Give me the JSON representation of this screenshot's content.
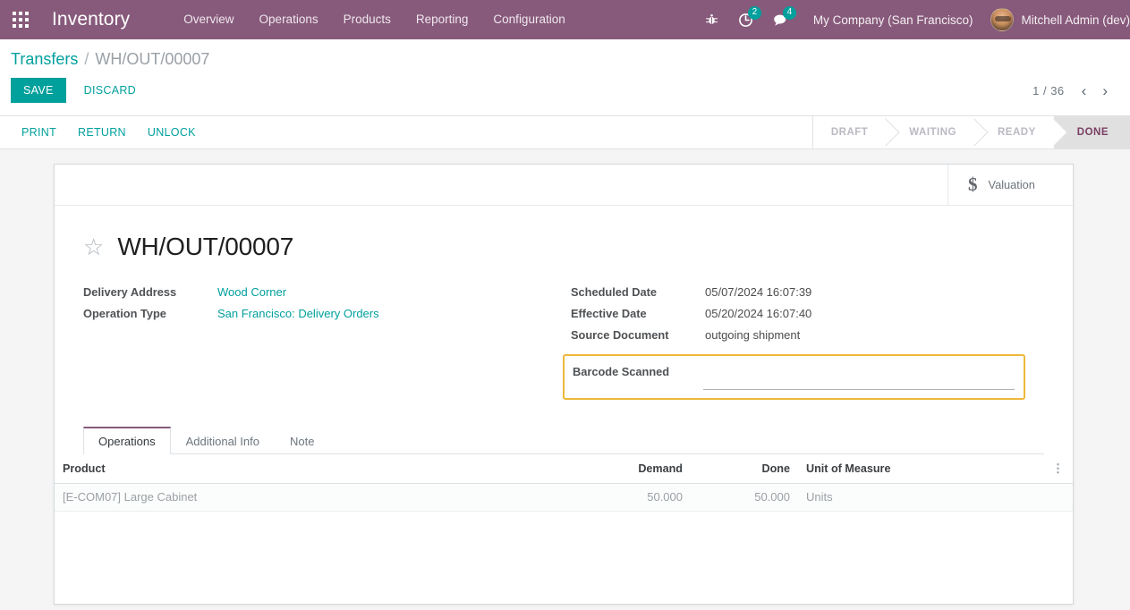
{
  "navbar": {
    "apps_icon": "apps-grid-icon",
    "brand": "Inventory",
    "menu": [
      {
        "label": "Overview"
      },
      {
        "label": "Operations"
      },
      {
        "label": "Products"
      },
      {
        "label": "Reporting"
      },
      {
        "label": "Configuration"
      }
    ],
    "icons": {
      "debug": {
        "name": "bug-icon",
        "glyph": "⚙"
      },
      "activity": {
        "name": "clock-activity-icon",
        "count": "2"
      },
      "messages": {
        "name": "chat-bubble-icon",
        "count": "4"
      }
    },
    "company": "My Company (San Francisco)",
    "user": "Mitchell Admin (dev)",
    "background_color": "#875a7b"
  },
  "control_panel": {
    "breadcrumb": {
      "root": "Transfers",
      "separator": "/",
      "current": "WH/OUT/00007"
    },
    "save_label": "SAVE",
    "discard_label": "DISCARD",
    "pager": {
      "value": "1 / 36",
      "prev": "‹",
      "next": "›"
    }
  },
  "action_bar": {
    "buttons": [
      {
        "label": "PRINT"
      },
      {
        "label": "RETURN"
      },
      {
        "label": "UNLOCK"
      }
    ],
    "statuses": [
      {
        "label": "DRAFT",
        "active": false
      },
      {
        "label": "WAITING",
        "active": false
      },
      {
        "label": "READY",
        "active": false
      },
      {
        "label": "DONE",
        "active": true
      }
    ],
    "active_status": "DONE",
    "active_color": "#7a3f64"
  },
  "form": {
    "stat_buttons": [
      {
        "icon": "dollar-icon",
        "glyph": "$",
        "label": "Valuation"
      }
    ],
    "favorite_icon": "star-outline-icon",
    "favorite_glyph": "☆",
    "title": "WH/OUT/00007",
    "left_fields": [
      {
        "label": "Delivery Address",
        "value": "Wood Corner",
        "is_link": true
      },
      {
        "label": "Operation Type",
        "value": "San Francisco: Delivery Orders",
        "is_link": true
      }
    ],
    "right_fields": [
      {
        "label": "Scheduled Date",
        "value": "05/07/2024 16:07:39",
        "is_link": false
      },
      {
        "label": "Effective Date",
        "value": "05/20/2024 16:07:40",
        "is_link": false
      },
      {
        "label": "Source Document",
        "value": "outgoing shipment",
        "is_link": false
      }
    ],
    "barcode": {
      "label": "Barcode Scanned",
      "value": "",
      "placeholder": "",
      "highlight_color": "#eeb83a"
    }
  },
  "notebook": {
    "tabs": [
      {
        "label": "Operations",
        "active": true
      },
      {
        "label": "Additional Info",
        "active": false
      },
      {
        "label": "Note",
        "active": false
      }
    ],
    "table": {
      "columns": [
        {
          "label": "Product",
          "align": "left"
        },
        {
          "label": "Demand",
          "align": "right"
        },
        {
          "label": "Done",
          "align": "right"
        },
        {
          "label": "Unit of Measure",
          "align": "left"
        }
      ],
      "optional_columns_icon": "vertical-dots-icon",
      "optional_columns_glyph": "⋮",
      "rows": [
        {
          "product": "[E-COM07] Large Cabinet",
          "demand": "50.000",
          "done": "50.000",
          "uom": "Units"
        }
      ]
    }
  }
}
